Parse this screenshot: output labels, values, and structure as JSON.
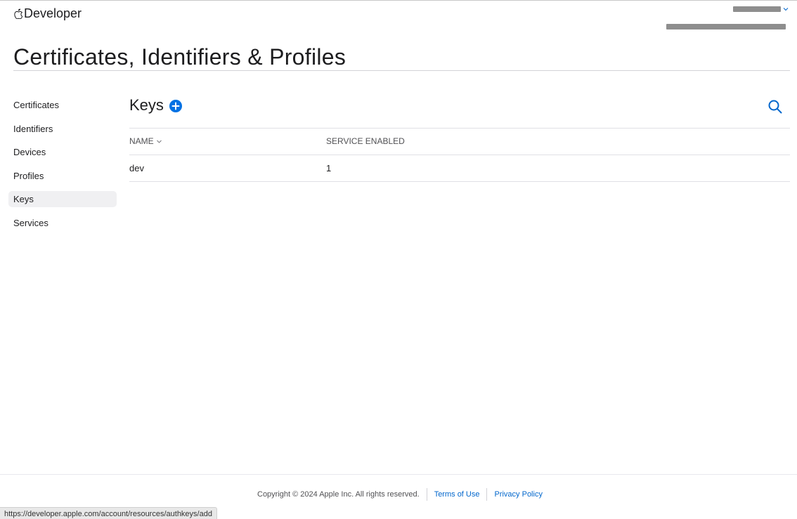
{
  "header": {
    "brand_label": "Developer",
    "title": "Certificates, Identifiers & Profiles"
  },
  "sidebar": {
    "items": [
      {
        "label": "Certificates"
      },
      {
        "label": "Identifiers"
      },
      {
        "label": "Devices"
      },
      {
        "label": "Profiles"
      },
      {
        "label": "Keys",
        "active": true
      },
      {
        "label": "Services"
      }
    ]
  },
  "main": {
    "section_title": "Keys",
    "table": {
      "columns": [
        "NAME",
        "SERVICE ENABLED"
      ],
      "rows": [
        {
          "name": "dev",
          "services": "1"
        }
      ]
    }
  },
  "footer": {
    "copyright": "Copyright © 2024 Apple Inc. All rights reserved.",
    "terms": "Terms of Use",
    "privacy": "Privacy Policy"
  },
  "status_url": "https://developer.apple.com/account/resources/authkeys/add",
  "colors": {
    "accent": "#0066cc",
    "add_button": "#0071e3",
    "text": "#1d1d1f",
    "active_bg": "#f0f0f2"
  },
  "icons": {
    "brand": "apple-logo-icon",
    "add": "plus-circle-icon",
    "search": "search-icon",
    "sort": "chevron-down-icon"
  }
}
